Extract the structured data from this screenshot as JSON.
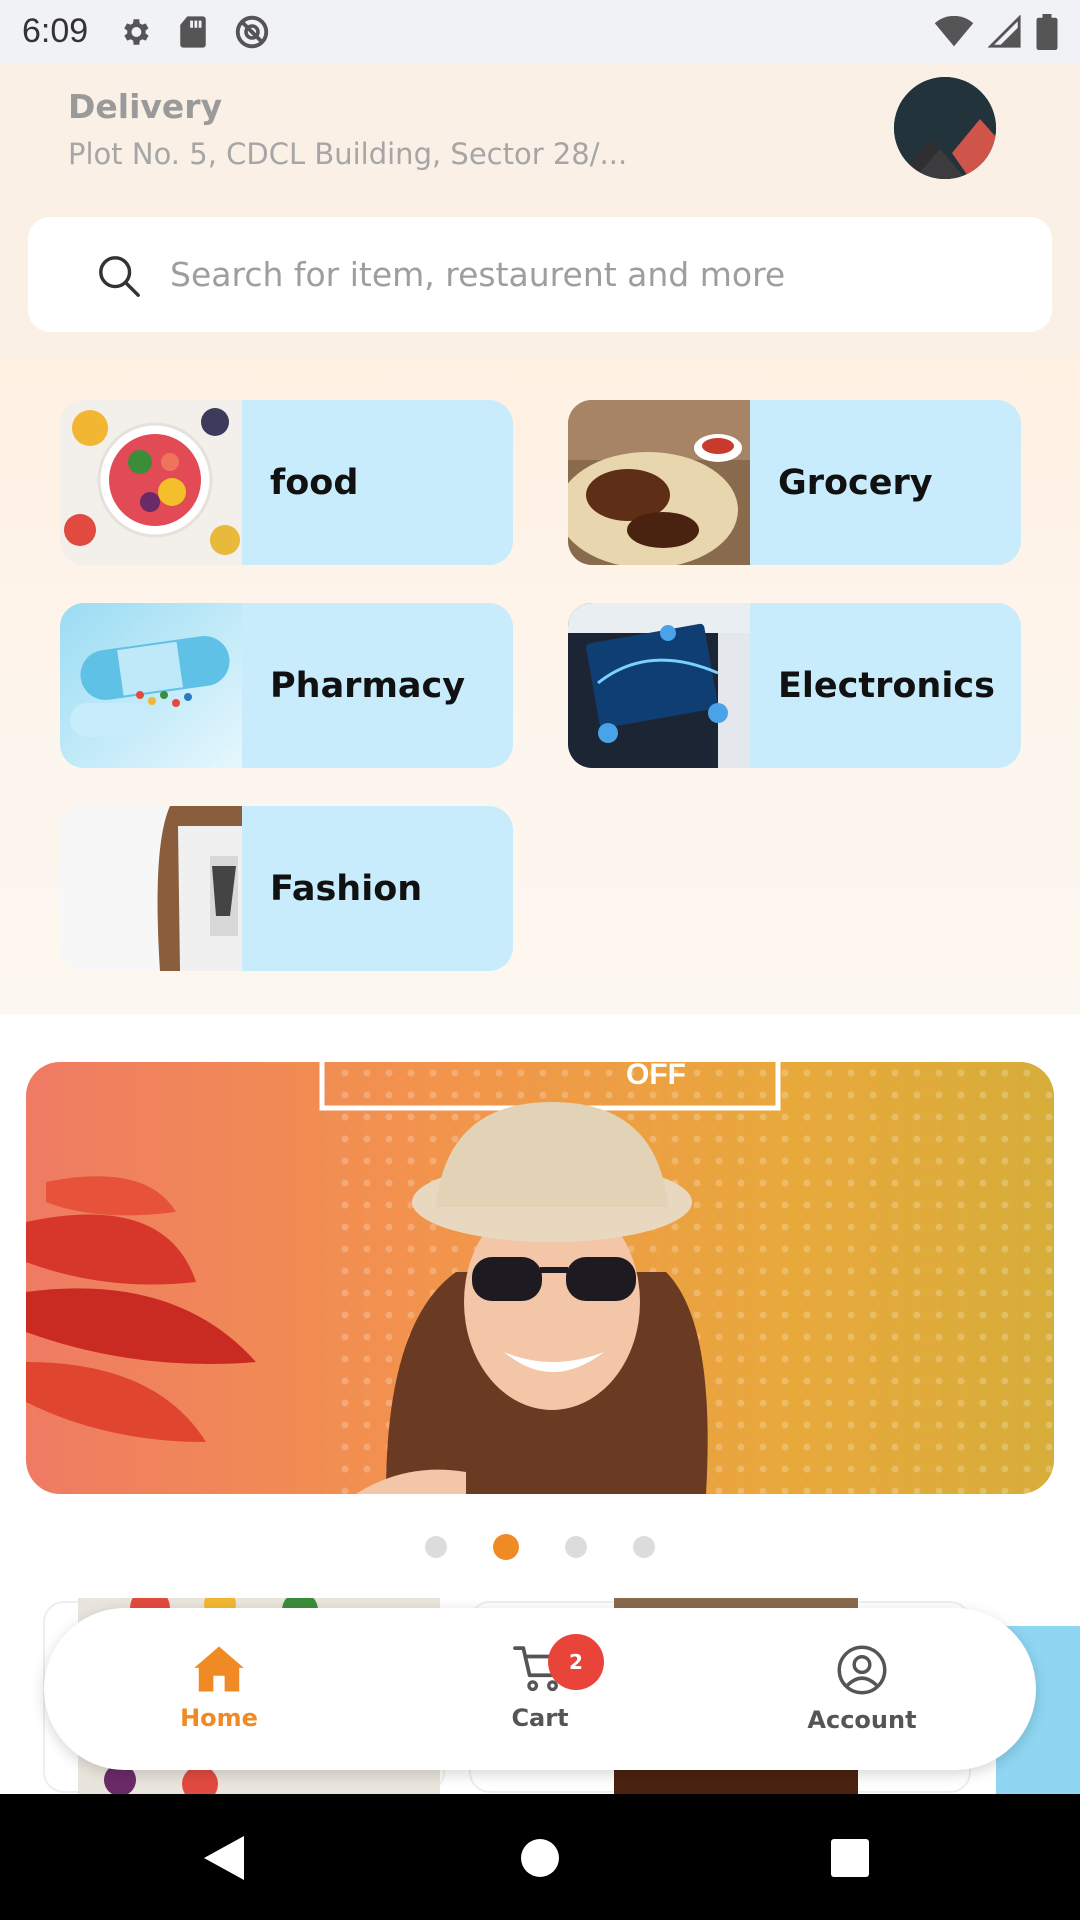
{
  "status_bar": {
    "time": "6:09",
    "left_icons": [
      "settings-icon",
      "sd-card-icon",
      "blocked-icon"
    ],
    "right_icons": [
      "wifi-icon",
      "signal-icon",
      "battery-icon"
    ]
  },
  "header": {
    "delivery_label": "Delivery",
    "address": "Plot No. 5, CDCL Building, Sector 28/..."
  },
  "search": {
    "placeholder": "Search for item, restaurent and more"
  },
  "categories": [
    {
      "label": "food"
    },
    {
      "label": "Grocery"
    },
    {
      "label": "Pharmacy"
    },
    {
      "label": "Electronics"
    },
    {
      "label": "Fashion"
    }
  ],
  "banner": {
    "text": "OFF",
    "active_slide": 2,
    "slide_count": 4
  },
  "bottom_nav": {
    "items": [
      {
        "label": "Home",
        "icon": "home-icon",
        "active": true
      },
      {
        "label": "Cart",
        "icon": "cart-icon",
        "active": false
      },
      {
        "label": "Account",
        "icon": "account-icon",
        "active": false
      }
    ],
    "cart_count": "2"
  },
  "system_nav": [
    "back-icon",
    "home-circle-icon",
    "recents-icon"
  ],
  "colors": {
    "accent": "#f08a24",
    "category_card": "#c8ecfb",
    "badge": "#e8443a"
  }
}
